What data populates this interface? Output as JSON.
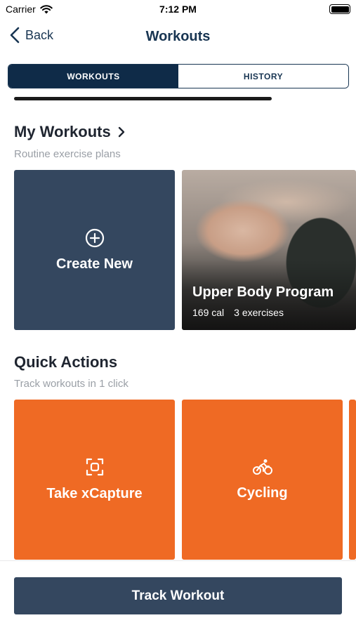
{
  "status_bar": {
    "carrier": "Carrier",
    "time": "7:12 PM"
  },
  "nav": {
    "back_label": "Back",
    "title": "Workouts"
  },
  "tabs": [
    {
      "label": "WORKOUTS",
      "active": true
    },
    {
      "label": "HISTORY",
      "active": false
    }
  ],
  "my_workouts": {
    "title": "My Workouts",
    "subtitle": "Routine exercise plans",
    "create_label": "Create New",
    "program": {
      "name": "Upper Body Program",
      "calories": "169 cal",
      "exercises": "3 exercises"
    }
  },
  "quick_actions": {
    "title": "Quick Actions",
    "subtitle": "Track workouts in 1 click",
    "items": [
      {
        "label": "Take xCapture",
        "icon": "capture-icon"
      },
      {
        "label": "Cycling",
        "icon": "cycling-icon"
      }
    ]
  },
  "footer": {
    "track_label": "Track Workout"
  },
  "colors": {
    "navy": "#0f2b48",
    "slate": "#34475f",
    "orange": "#ef6a24",
    "subtext": "#9a9fa6"
  }
}
